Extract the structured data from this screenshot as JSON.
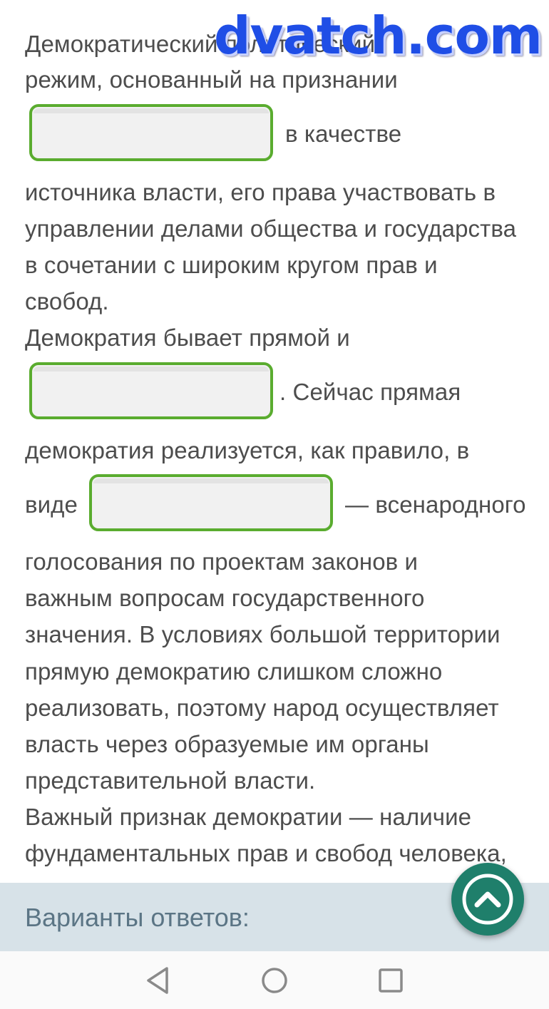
{
  "watermark": "dvatch.com",
  "text": {
    "l1": "Демократический политический",
    "l2": "режим, основанный на признании",
    "l3_after": "в качестве",
    "l4": "источника власти, его права участвовать в",
    "l5": "управлении делами общества и государства",
    "l6": "в сочетании с широким кругом прав и",
    "l7": "свобод.",
    "l8": "Демократия бывает прямой и",
    "l9_after": ". Сейчас прямая",
    "l10": "демократия реализуется, как правило, в",
    "l11_before": "виде",
    "l11_after": "— всенародного",
    "l12": "голосования по проектам законов и",
    "l13": "важным вопросам государственного",
    "l14": "значения. В условиях большой территории",
    "l15": "прямую демократию слишком сложно",
    "l16": "реализовать, поэтому народ осуществляет",
    "l17": "власть через образуемые им органы",
    "l18": "представительной власти.",
    "l19": "Важный признак демократии — наличие",
    "l20": "фундаментальных прав и свобод человека,"
  },
  "blanks": [
    {
      "value": "",
      "placeholder": ""
    },
    {
      "value": "",
      "placeholder": ""
    },
    {
      "value": "",
      "placeholder": ""
    }
  ],
  "answers": {
    "title": "Варианты ответов:"
  },
  "fab": {
    "icon": "chevron-up-icon",
    "color": "#1f7f6b"
  },
  "navbar": {
    "icons": [
      "back-triangle-icon",
      "home-circle-icon",
      "recents-square-icon"
    ]
  },
  "colors": {
    "text": "#4d4d4d",
    "blank_border": "#5aac2f",
    "answers_bar": "#d7e2e8",
    "answers_title": "#5b7585",
    "watermark": "#1f4ee6"
  }
}
